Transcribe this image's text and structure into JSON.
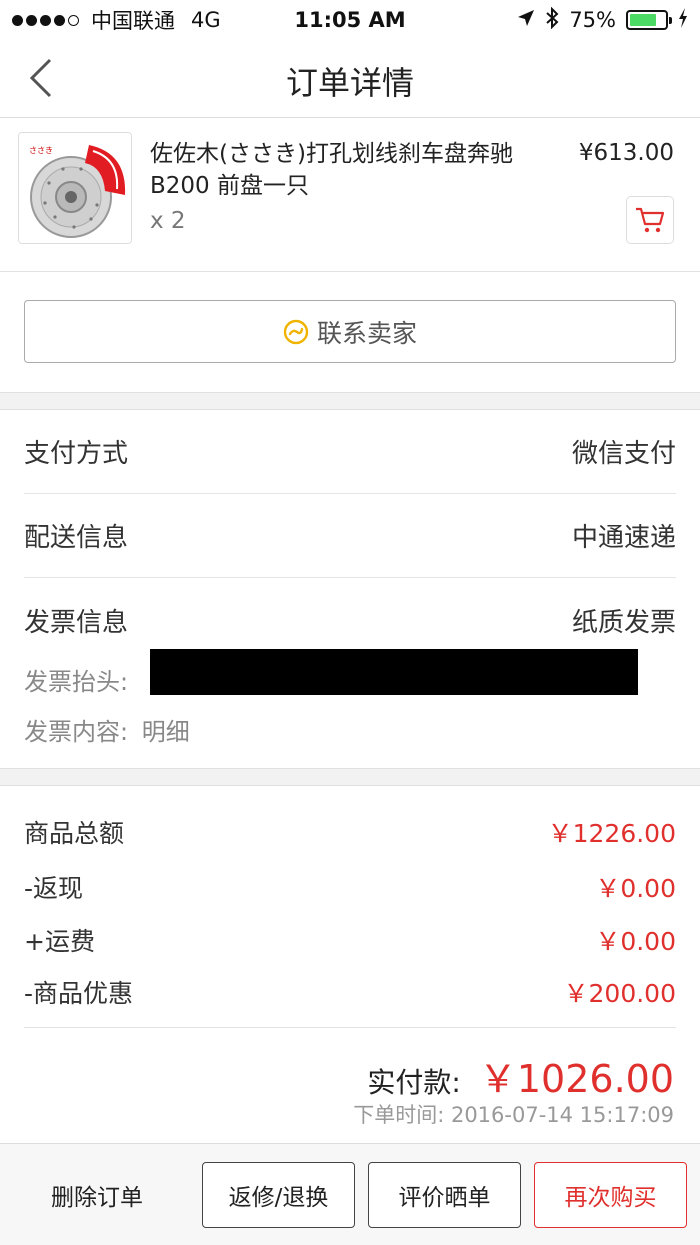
{
  "status_bar": {
    "carrier": "中国联通",
    "network": "4G",
    "time": "11:05 AM",
    "battery": "75%",
    "battery_level": 0.75
  },
  "nav": {
    "title": "订单详情"
  },
  "product": {
    "name": "佐佐木(ささき)打孔划线刹车盘奔驰B200 前盘一只",
    "quantity": "x 2",
    "price": "¥613.00"
  },
  "contact_seller": "联系卖家",
  "payment": {
    "label": "支付方式",
    "value": "微信支付"
  },
  "delivery": {
    "label": "配送信息",
    "value": "中通速递"
  },
  "invoice": {
    "label": "发票信息",
    "value": "纸质发票",
    "title_label": "发票抬头:",
    "content_label": "发票内容:",
    "content_value": "明细"
  },
  "summary": {
    "items": [
      {
        "label": "商品总额",
        "value": "￥1226.00"
      },
      {
        "label": "-返现",
        "value": "￥0.00"
      },
      {
        "label": "+运费",
        "value": "￥0.00"
      },
      {
        "label": "-商品优惠",
        "value": "￥200.00"
      }
    ],
    "total_label": "实付款:",
    "total_value": "￥1026.00",
    "order_time": "下单时间: 2016-07-14 15:17:09"
  },
  "actions": {
    "delete": "删除订单",
    "return": "返修/退换",
    "review": "评价晒单",
    "rebuy": "再次购买"
  },
  "colors": {
    "accent_red": "#e0302d",
    "battery_green": "#4cd964",
    "contact_icon": "#f0b400"
  }
}
